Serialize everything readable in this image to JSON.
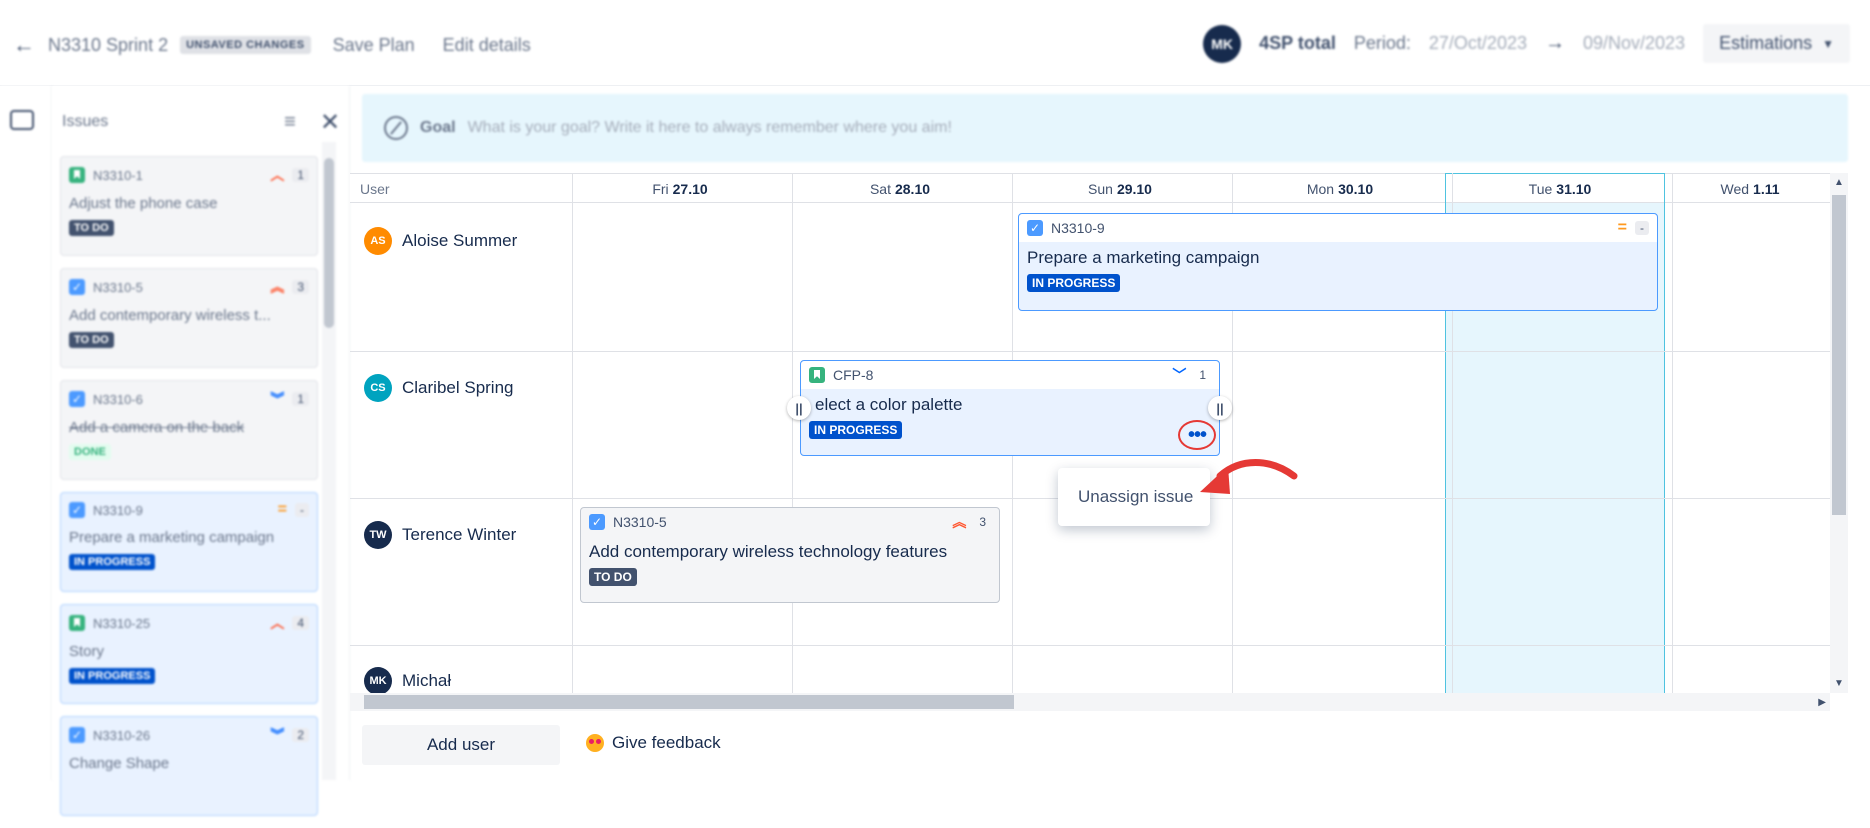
{
  "topbar": {
    "sprint_name": "N3310 Sprint 2",
    "unsaved_badge": "UNSAVED CHANGES",
    "save_plan": "Save Plan",
    "edit_details": "Edit details",
    "avatar_initials": "MK",
    "sp_total": "4SP total",
    "period_label": "Period:",
    "period_start": "27/Oct/2023",
    "period_end": "09/Nov/2023",
    "estimations": "Estimations"
  },
  "issues_panel": {
    "title": "Issues",
    "cards": [
      {
        "key": "N3310-1",
        "summary": "Adjust the phone case",
        "status": "TO DO",
        "est": "1"
      },
      {
        "key": "N3310-5",
        "summary": "Add contemporary wireless t...",
        "status": "TO DO",
        "est": "3"
      },
      {
        "key": "N3310-6",
        "summary": "Add a camera on the back",
        "status": "DONE",
        "est": "1"
      },
      {
        "key": "N3310-9",
        "summary": "Prepare a marketing campaign",
        "status": "IN PROGRESS",
        "est": "-"
      },
      {
        "key": "N3310-25",
        "summary": "Story",
        "status": "IN PROGRESS",
        "est": "4"
      },
      {
        "key": "N3310-26",
        "summary": "Change Shape",
        "status": "",
        "est": "2"
      }
    ]
  },
  "goal": {
    "label": "Goal",
    "placeholder": "What is your goal? Write it here to always remember where you aim!"
  },
  "grid": {
    "user_header": "User",
    "days": [
      {
        "name": "Fri",
        "date": "27.10"
      },
      {
        "name": "Sat",
        "date": "28.10"
      },
      {
        "name": "Sun",
        "date": "29.10"
      },
      {
        "name": "Mon",
        "date": "30.10"
      },
      {
        "name": "Tue",
        "date": "31.10"
      },
      {
        "name": "Wed",
        "date": "1.11"
      }
    ],
    "users": [
      {
        "initials": "AS",
        "name": "Aloise Summer",
        "color": "#ff8b00"
      },
      {
        "initials": "CS",
        "name": "Claribel Spring",
        "color": "#00a3bf"
      },
      {
        "initials": "TW",
        "name": "Terence Winter",
        "color": "#172b4d"
      },
      {
        "initials": "MK",
        "name": "Michał",
        "color": "#172b4d"
      }
    ]
  },
  "plan_cards": {
    "c1": {
      "key": "N3310-9",
      "title": "Prepare a marketing campaign",
      "status": "IN PROGRESS",
      "est": "-"
    },
    "c2": {
      "key": "CFP-8",
      "title": "elect a color palette",
      "status": "IN PROGRESS",
      "est": "1"
    },
    "c3": {
      "key": "N3310-5",
      "title": "Add contemporary wireless technology features",
      "status": "TO DO",
      "est": "3"
    }
  },
  "context_menu": {
    "unassign": "Unassign issue"
  },
  "footer": {
    "add_user": "Add user",
    "give_feedback": "Give feedback"
  },
  "colors": {
    "accent": "#0052cc",
    "today_highlight": "#4fc3e0",
    "annotation": "#e53935"
  }
}
